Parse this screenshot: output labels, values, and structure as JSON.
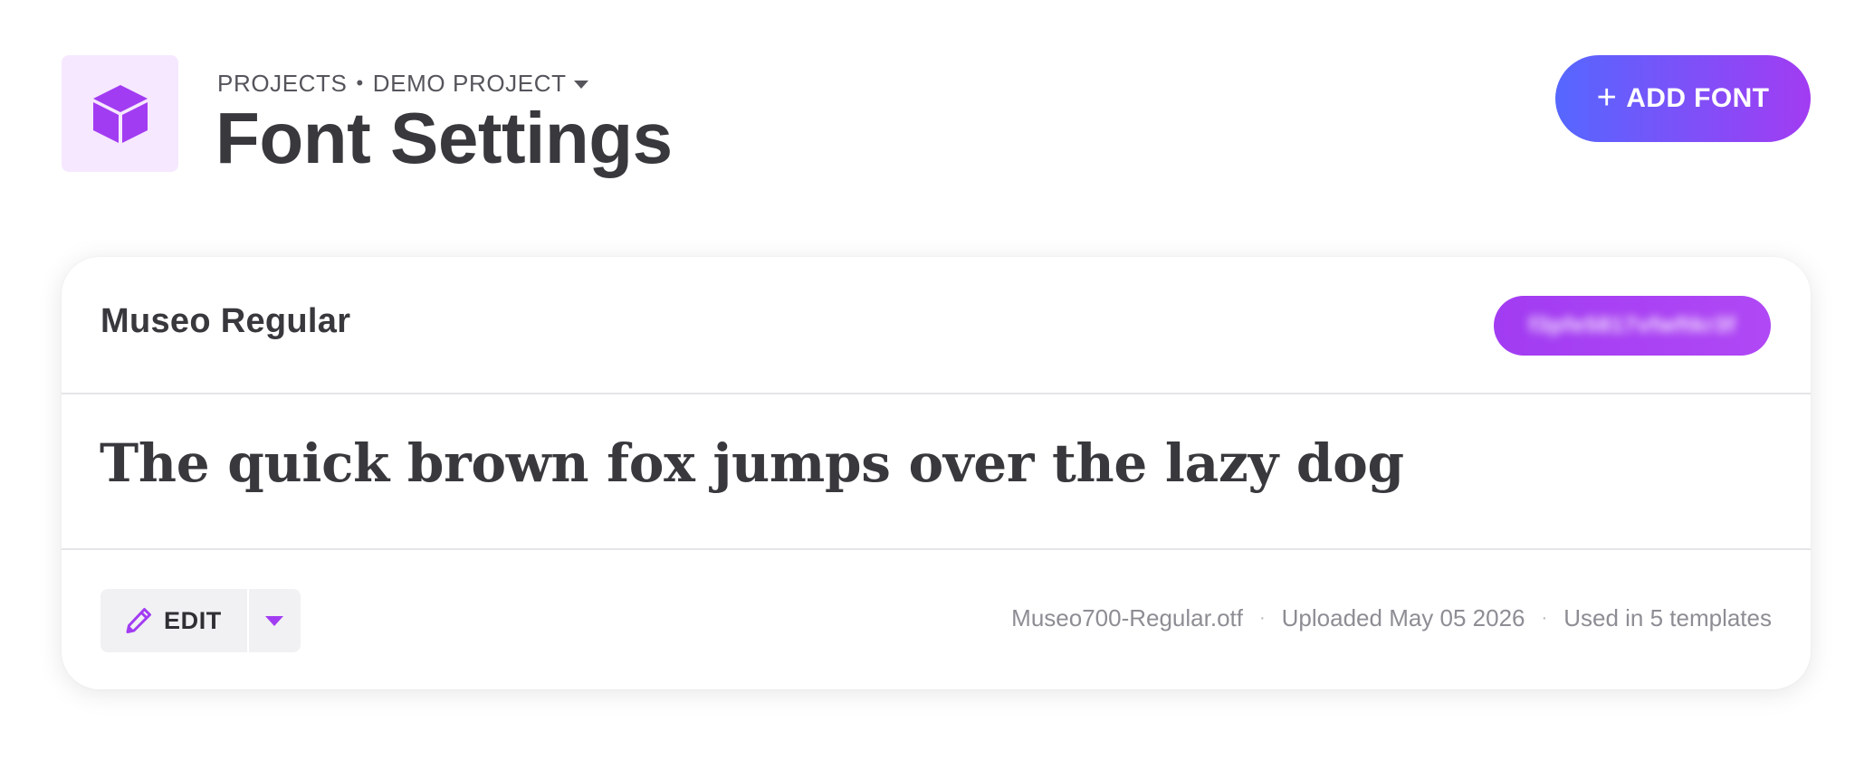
{
  "header": {
    "breadcrumb": {
      "projects_label": "PROJECTS",
      "separator": "•",
      "project_label": "DEMO PROJECT"
    },
    "title": "Font Settings",
    "add_font_label": "ADD FONT",
    "add_font_icon": "plus-icon",
    "project_icon": "cube-icon"
  },
  "font_card": {
    "font_name": "Museo Regular",
    "font_id": "f3pfe5817vfwftkr3f",
    "preview_text": "The quick brown fox jumps over the lazy dog",
    "edit_label": "EDIT",
    "edit_icon": "pencil-icon",
    "file_name": "Museo700-Regular.otf",
    "meta_separator": "·",
    "uploaded": "Uploaded May 05 2026",
    "usage": "Used in 5 templates"
  },
  "colors": {
    "accent_purple": "#a23cf2",
    "accent_blue": "#5567ff",
    "tile_bg": "#f6e8ff",
    "text_dark": "#38383d",
    "text_muted": "#8d8d94"
  }
}
